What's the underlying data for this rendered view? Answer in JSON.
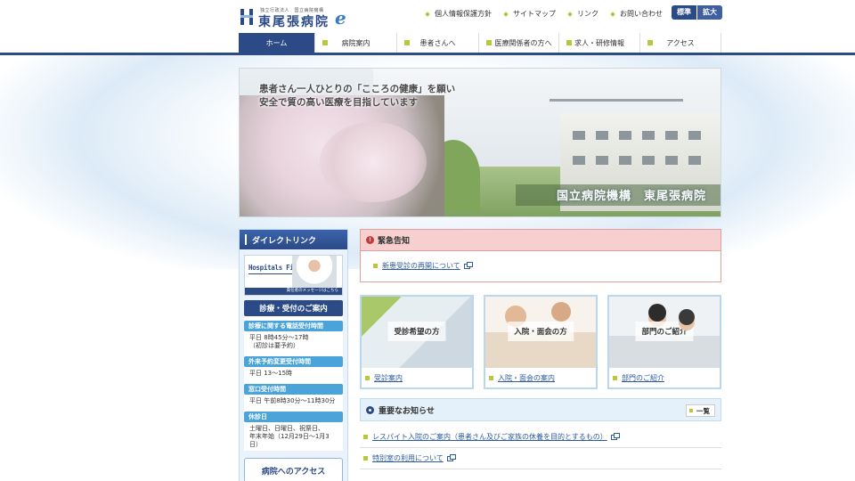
{
  "header": {
    "logo_small": "独立行政法人　国立病院機構",
    "logo_main": "東尾張病院",
    "logo_e": "e",
    "util_links": [
      "個人情報保護方針",
      "サイトマップ",
      "リンク",
      "お問い合わせ"
    ],
    "font_standard": "標準",
    "font_large": "拡大"
  },
  "nav": {
    "items": [
      "ホーム",
      "病院案内",
      "患者さんへ",
      "医療関係者の方へ",
      "求人・研修情報",
      "アクセス"
    ],
    "active_index": 0
  },
  "hero": {
    "copy_line1": "患者さん一人ひとりの「こころの健康」を願い",
    "copy_line2": "安全で質の高い医療を目指しています",
    "banner": "国立病院機構　東尾張病院"
  },
  "sidebar": {
    "direct_link_title": "ダイレクトリンク",
    "hospitals_file_title": "Hospitals File",
    "hospitals_file_caption": "責任者のメッセージはこちら",
    "info_title": "診療・受付のご案内",
    "sections": [
      {
        "label": "診療に関する電話受付時間",
        "text": "平日 8時45分〜17時\n（初診は要予約）"
      },
      {
        "label": "外来予約変更受付時間",
        "text": "平日 13〜15時"
      },
      {
        "label": "窓口受付時間",
        "text": "平日 午前8時30分〜11時30分"
      },
      {
        "label": "休診日",
        "text": "土曜日、日曜日、祝祭日、\n年末年始（12月29日〜1月3日）"
      }
    ],
    "access_label": "病院へのアクセス"
  },
  "alert": {
    "title": "緊急告知",
    "icon": "!",
    "link": "新患受診の再開について"
  },
  "cards": [
    {
      "label": "受診希望の方",
      "link": "受診案内"
    },
    {
      "label": "入院・面会の方",
      "link": "入院・面会の案内"
    },
    {
      "label": "部門のご紹介",
      "link": "部門のご紹介"
    }
  ],
  "news": {
    "title": "重要なお知らせ",
    "all_label": "一覧",
    "items": [
      "レスパイト入院のご案内（患者さん及びご家族の休養を目的とするもの）",
      "特別室の利用について"
    ]
  },
  "colors": {
    "primary": "#2b4a86",
    "accent_bullet": "#b8c83a",
    "alert_bg": "#f7cfcf",
    "sub_label": "#4aa3d9"
  }
}
